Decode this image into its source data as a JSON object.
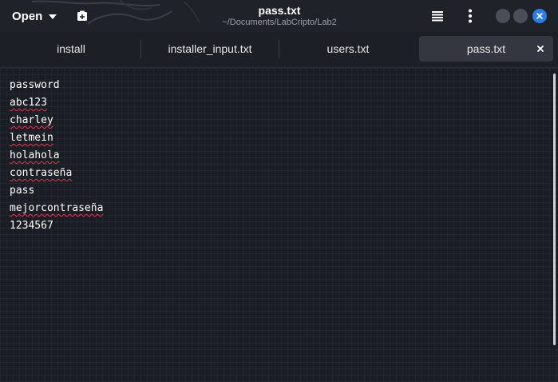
{
  "header": {
    "open_label": "Open",
    "title": "pass.txt",
    "subtitle": "~/Documents/LabCripto/Lab2"
  },
  "tabs": [
    {
      "label": "install",
      "active": false
    },
    {
      "label": "installer_input.txt",
      "active": false
    },
    {
      "label": "users.txt",
      "active": false
    },
    {
      "label": "pass.txt",
      "active": true
    }
  ],
  "editor": {
    "lines": [
      {
        "text": "password",
        "misspelled": false
      },
      {
        "text": "abc123",
        "misspelled": true
      },
      {
        "text": "charley",
        "misspelled": true
      },
      {
        "text": "letmein",
        "misspelled": true
      },
      {
        "text": "holahola",
        "misspelled": true
      },
      {
        "text": "contraseña",
        "misspelled": true
      },
      {
        "text": "pass",
        "misspelled": false
      },
      {
        "text": "mejorcontraseña",
        "misspelled": true
      },
      {
        "text": "1234567",
        "misspelled": false
      }
    ]
  },
  "icons": {
    "new_document": "new-document-icon",
    "menu": "hamburger-menu-icon",
    "more": "vertical-ellipsis-icon",
    "close": "close-icon"
  },
  "colors": {
    "accent": "#2a7de1",
    "spellcheck": "#e0384a"
  }
}
